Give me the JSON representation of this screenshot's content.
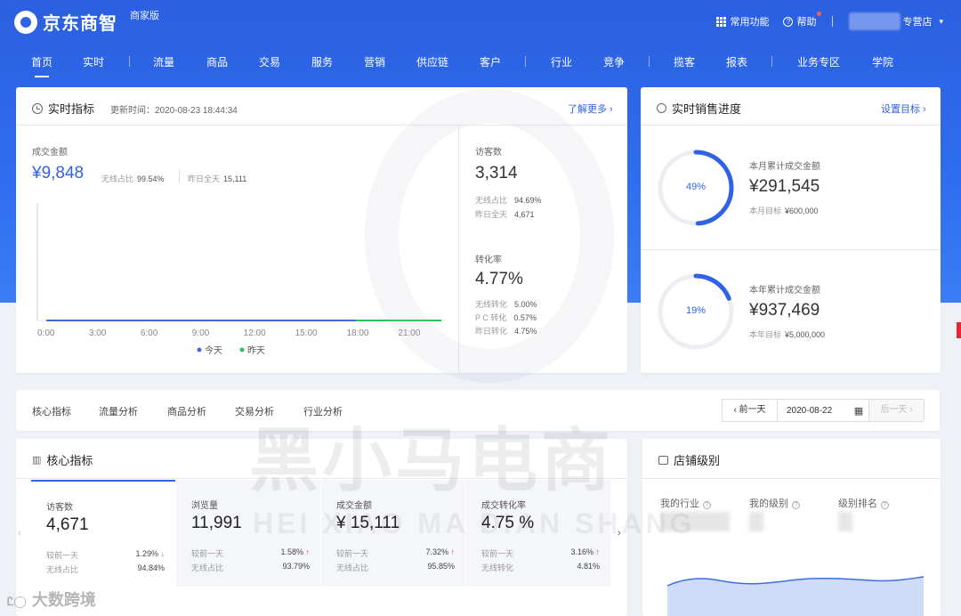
{
  "header": {
    "logo_text": "京东商智",
    "logo_sub": "商家版",
    "common_functions": "常用功能",
    "help": "帮助",
    "store_type": "专营店"
  },
  "nav": {
    "items": [
      "首页",
      "实时",
      "流量",
      "商品",
      "交易",
      "服务",
      "营销",
      "供应链",
      "客户",
      "行业",
      "竞争",
      "揽客",
      "报表",
      "业务专区",
      "学院"
    ],
    "active": "首页"
  },
  "realtime": {
    "title": "实时指标",
    "update_time": "更新时间：2020-08-23 18:44:34",
    "learn_more": "了解更多 ›",
    "gmv_label": "成交金额",
    "gmv_value": "¥9,848",
    "wireless_ratio_label": "无线占比",
    "wireless_ratio_value": "99.54%",
    "yesterday_label": "昨日全天",
    "yesterday_value": "15,111",
    "visitors_label": "访客数",
    "visitors_value": "3,314",
    "visitors_wireless_label": "无线占比",
    "visitors_wireless_value": "94.69%",
    "visitors_yesterday_label": "昨日全天",
    "visitors_yesterday_value": "4,671",
    "conv_label": "转化率",
    "conv_value": "4.77%",
    "conv_wireless_label": "无线转化",
    "conv_wireless_value": "5.00%",
    "conv_pc_label": "P C 转化",
    "conv_pc_value": "0.57%",
    "conv_yesterday_label": "昨日转化",
    "conv_yesterday_value": "4.75%"
  },
  "chart_data": {
    "type": "area",
    "x_ticks": [
      "0:00",
      "3:00",
      "6:00",
      "9:00",
      "12:00",
      "15:00",
      "18:00",
      "21:00"
    ],
    "series": [
      {
        "name": "今天",
        "color": "#3a6fe0",
        "x": [
          0,
          1,
          2,
          3,
          4,
          5,
          6,
          7,
          8,
          9,
          10,
          11,
          12,
          13,
          14,
          15,
          16,
          17,
          18
        ],
        "y": [
          0,
          0,
          0,
          0,
          0,
          0,
          0,
          0,
          0,
          0,
          0,
          0,
          0,
          0,
          0,
          0,
          0,
          0,
          0
        ]
      },
      {
        "name": "昨天",
        "color": "#2ec24a",
        "x": [
          0,
          1,
          2,
          3,
          4,
          5,
          6,
          7,
          8,
          9,
          10,
          11,
          12,
          13,
          14,
          15,
          16,
          17,
          18,
          19,
          20,
          21,
          22,
          23
        ],
        "y": [
          0,
          0,
          0,
          0,
          0,
          0,
          0,
          0,
          0,
          0,
          0,
          0,
          0,
          0,
          0,
          0,
          0,
          0,
          0,
          0,
          0,
          0,
          0,
          0
        ]
      }
    ],
    "legend": "bottom"
  },
  "sales_progress": {
    "title": "实时销售进度",
    "set_target": "设置目标 ›",
    "month": {
      "percent": 49,
      "percent_label": "49%",
      "label": "本月累计成交金额",
      "value": "¥291,545",
      "target_label": "本月目标",
      "target_value": "¥600,000"
    },
    "year": {
      "percent": 19,
      "percent_label": "19%",
      "label": "本年累计成交金额",
      "value": "¥937,469",
      "target_label": "本年目标",
      "target_value": "¥5,000,000"
    }
  },
  "tabs": {
    "items": [
      "核心指标",
      "流量分析",
      "商品分析",
      "交易分析",
      "行业分析"
    ],
    "prev_day": "‹ 前一天",
    "date": "2020-08-22",
    "next_day": "后一天 ›"
  },
  "core": {
    "title": "核心指标",
    "metrics": [
      {
        "label": "访客数",
        "value": "4,671",
        "r1_label": "较前一天",
        "r1_value": "1.29%",
        "r1_dir": "down",
        "r2_label": "无线占比",
        "r2_value": "94.84%"
      },
      {
        "label": "浏览量",
        "value": "11,991",
        "r1_label": "较前一天",
        "r1_value": "1.58%",
        "r1_dir": "up",
        "r2_label": "无线占比",
        "r2_value": "93.79%"
      },
      {
        "label": "成交金额",
        "value": "¥ 15,111",
        "r1_label": "较前一天",
        "r1_value": "7.32%",
        "r1_dir": "up",
        "r2_label": "无线占比",
        "r2_value": "95.85%"
      },
      {
        "label": "成交转化率",
        "value": "4.75 %",
        "r1_label": "较前一天",
        "r1_value": "3.16%",
        "r1_dir": "up",
        "r2_label": "无线转化",
        "r2_value": "4.81%"
      }
    ]
  },
  "store_level": {
    "title": "店铺级别",
    "col1": "我的行业",
    "col2": "我的级别",
    "col3": "级别排名"
  },
  "watermark": {
    "cn": "黑小马电商",
    "en": "HEI XIAO MA DIAN SHANG",
    "brand": "大数跨境"
  }
}
